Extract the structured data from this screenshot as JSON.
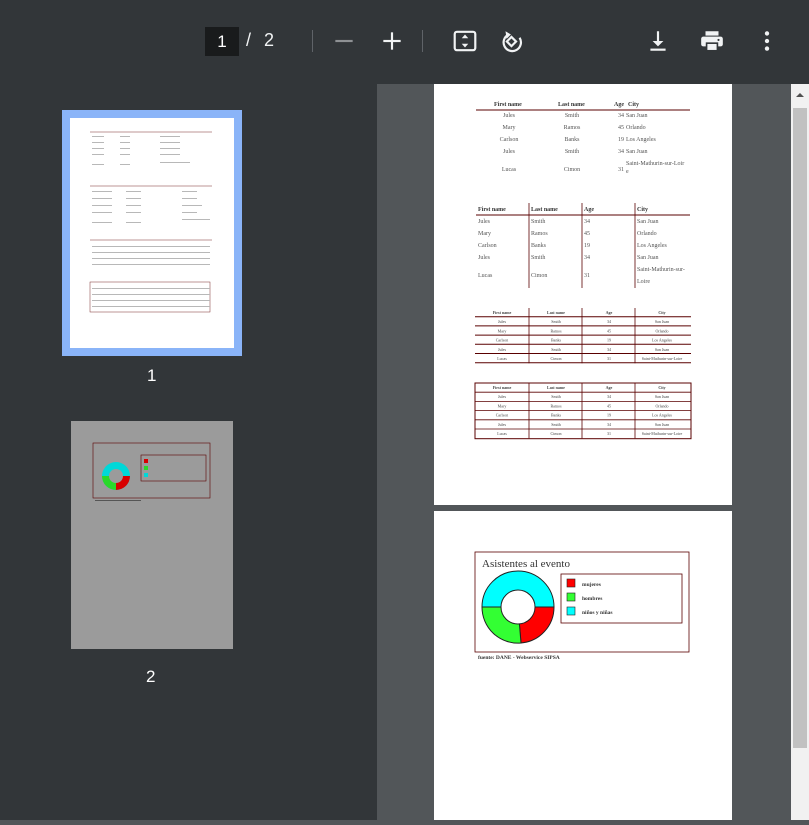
{
  "toolbar": {
    "current_page": "1",
    "separator": "/",
    "total_pages": "2",
    "icons": [
      "zoom-out-icon",
      "zoom-in-icon",
      "fit-page-icon",
      "rotate-icon",
      "download-icon",
      "print-icon",
      "more-vert-icon"
    ]
  },
  "sidebar": {
    "thumbnails": [
      {
        "label": "1",
        "selected": true
      },
      {
        "label": "2",
        "selected": false
      }
    ]
  },
  "document": {
    "table": {
      "headers": [
        "First name",
        "Last name",
        "Age",
        "City"
      ],
      "rows": [
        [
          "Jules",
          "Smith",
          "34",
          "San Juan"
        ],
        [
          "Mary",
          "Ramos",
          "45",
          "Orlando"
        ],
        [
          "Carlson",
          "Banks",
          "19",
          "Los Angeles"
        ],
        [
          "Jules",
          "Smith",
          "34",
          "San Juan"
        ],
        [
          "Lucas",
          "Cimon",
          "31",
          "Saint-Mathurin-sur-Loire"
        ]
      ]
    },
    "chart": {
      "title": "Asistentes al evento",
      "legend": [
        {
          "label": "mujeres",
          "color": "#ff0000"
        },
        {
          "label": "hombres",
          "color": "#33ff33"
        },
        {
          "label": "niños y niñas",
          "color": "#00ffff"
        }
      ],
      "source": "fuente: DANE - Webservice SIPSA"
    }
  },
  "colors": {
    "toolbar_bg": "#323639",
    "viewer_bg": "#525659",
    "selected_thumb": "#8ab4f8",
    "table_rule": "#5a0000"
  }
}
